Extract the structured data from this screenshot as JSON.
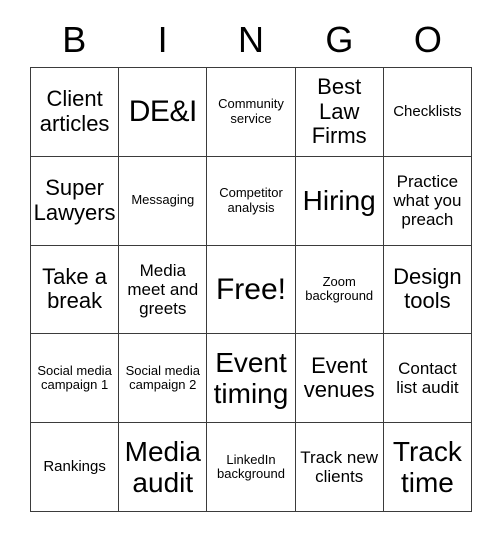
{
  "card": {
    "title": "BINGO",
    "header_letters": [
      "B",
      "I",
      "N",
      "G",
      "O"
    ],
    "border_color": "#3b3b3b",
    "background_color": "#ffffff",
    "text_color": "#000000",
    "rows": 5,
    "columns": 5,
    "cells": [
      [
        {
          "text": "Client articles",
          "size": "md"
        },
        {
          "text": "DE&I",
          "size": "xl"
        },
        {
          "text": "Community service",
          "size": "xxs"
        },
        {
          "text": "Best Law Firms",
          "size": "md"
        },
        {
          "text": "Checklists",
          "size": "xs"
        }
      ],
      [
        {
          "text": "Super Lawyers",
          "size": "md"
        },
        {
          "text": "Messaging",
          "size": "xxs"
        },
        {
          "text": "Competitor analysis",
          "size": "xxs"
        },
        {
          "text": "Hiring",
          "size": "lg"
        },
        {
          "text": "Practice what you preach",
          "size": "sm"
        }
      ],
      [
        {
          "text": "Take a break",
          "size": "md"
        },
        {
          "text": "Media meet and greets",
          "size": "sm"
        },
        {
          "text": "Free!",
          "size": "xl"
        },
        {
          "text": "Zoom background",
          "size": "xxs"
        },
        {
          "text": "Design tools",
          "size": "md"
        }
      ],
      [
        {
          "text": "Social media campaign 1",
          "size": "xxs"
        },
        {
          "text": "Social media campaign 2",
          "size": "xxs"
        },
        {
          "text": "Event timing",
          "size": "lg"
        },
        {
          "text": "Event venues",
          "size": "md"
        },
        {
          "text": "Contact list audit",
          "size": "sm"
        }
      ],
      [
        {
          "text": "Rankings",
          "size": "xs"
        },
        {
          "text": "Media audit",
          "size": "lg"
        },
        {
          "text": "LinkedIn background",
          "size": "xxs"
        },
        {
          "text": "Track new clients",
          "size": "sm"
        },
        {
          "text": "Track time",
          "size": "lg"
        }
      ]
    ]
  }
}
